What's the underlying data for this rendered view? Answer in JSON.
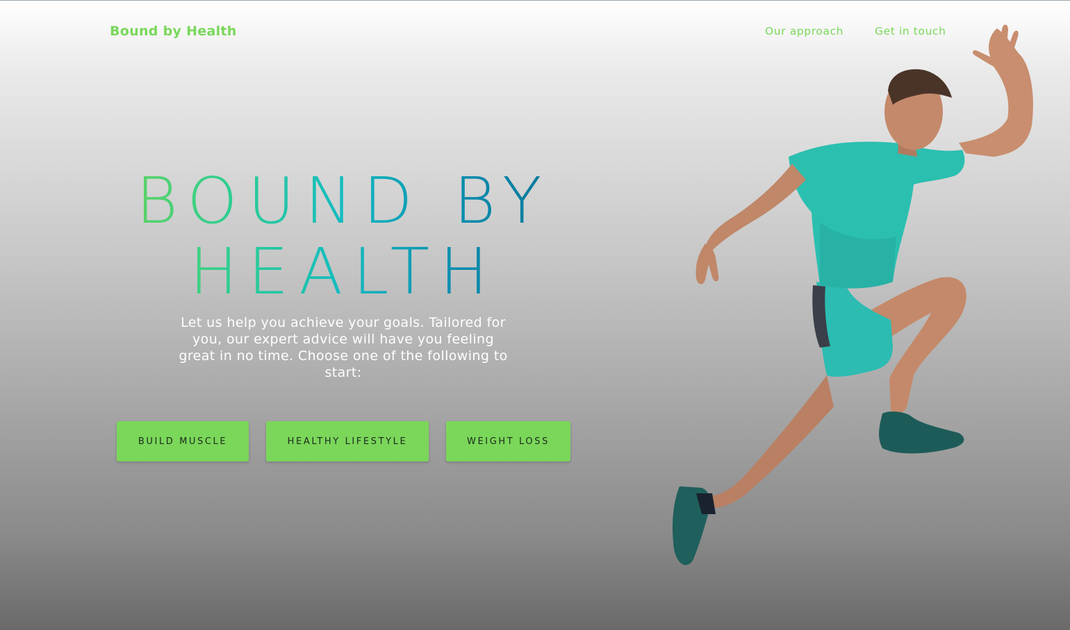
{
  "header": {
    "brand": "Bound by Health",
    "nav": [
      {
        "label": "Our approach"
      },
      {
        "label": "Get in touch"
      }
    ]
  },
  "hero": {
    "title_line1": "BOUND BY",
    "title_line2": "HEALTH",
    "description": "Let us help you achieve your goals. Tailored for you, our expert advice will have you feeling great in no time. Choose one of the following to start:",
    "buttons": [
      {
        "label": "BUILD MUSCLE"
      },
      {
        "label": "HEALTHY LIFESTYLE"
      },
      {
        "label": "WEIGHT LOSS"
      }
    ]
  },
  "image": {
    "icon": "runner-illustration"
  },
  "colors": {
    "accent": "#79d85a",
    "button": "#7ad75a",
    "gradient_start": "#6fd457",
    "gradient_end": "#087293",
    "shirt": "#2bbfb0"
  }
}
